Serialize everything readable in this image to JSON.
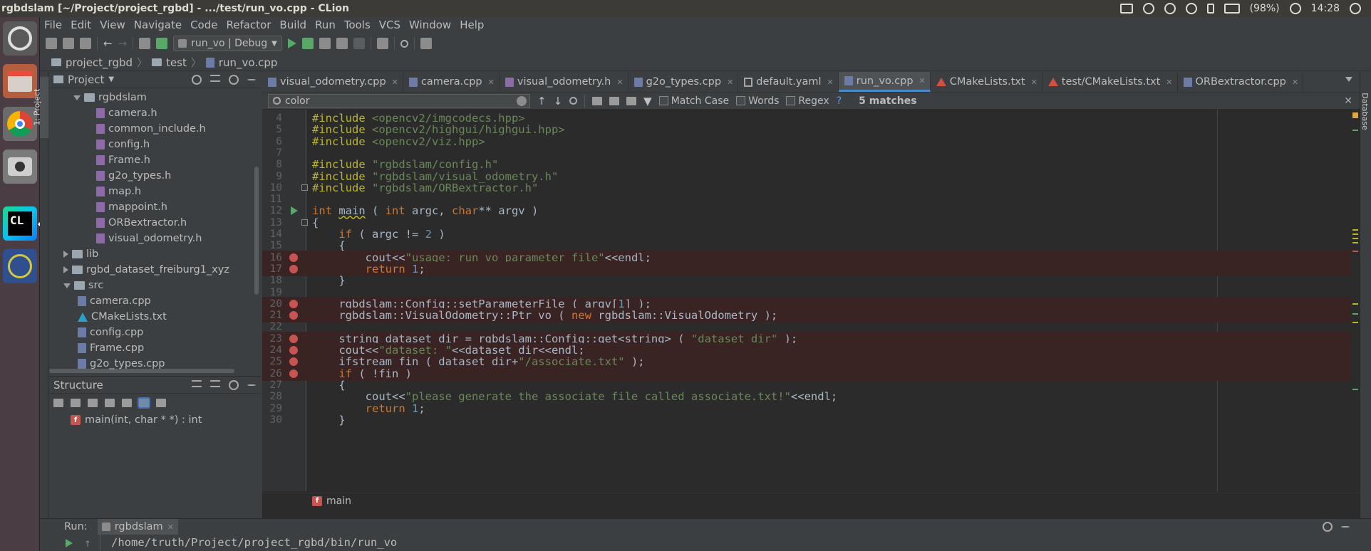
{
  "window": {
    "title": "rgbdslam [~/Project/project_rgbd] - .../test/run_vo.cpp - CLion"
  },
  "system_tray": {
    "battery": "(98%)",
    "time": "14:28"
  },
  "launcher": {
    "apps": [
      "ubuntu-dash-icon",
      "file-cabinet-icon",
      "chrome-icon",
      "camera-icon",
      "clion-icon",
      "settings-star-icon"
    ],
    "clion_badge": "CL"
  },
  "menu": {
    "items": [
      "File",
      "Edit",
      "View",
      "Navigate",
      "Code",
      "Refactor",
      "Build",
      "Run",
      "Tools",
      "VCS",
      "Window",
      "Help"
    ]
  },
  "toolbar": {
    "run_config": "run_vo | Debug"
  },
  "breadcrumb": {
    "items": [
      "project_rgbd",
      "test",
      "run_vo.cpp"
    ]
  },
  "left_strip": {
    "tab": "1: Project"
  },
  "right_strip": {
    "tab": "Database"
  },
  "project_panel": {
    "title": "Project",
    "tree": [
      {
        "label": "rgbdslam",
        "type": "dir",
        "state": "open",
        "depth": 1
      },
      {
        "label": "camera.h",
        "type": "h",
        "depth": 2
      },
      {
        "label": "common_include.h",
        "type": "h",
        "depth": 2
      },
      {
        "label": "config.h",
        "type": "h",
        "depth": 2
      },
      {
        "label": "Frame.h",
        "type": "h",
        "depth": 2
      },
      {
        "label": "g2o_types.h",
        "type": "h",
        "depth": 2
      },
      {
        "label": "map.h",
        "type": "h",
        "depth": 2
      },
      {
        "label": "mappoint.h",
        "type": "h",
        "depth": 2
      },
      {
        "label": "ORBextractor.h",
        "type": "h",
        "depth": 2
      },
      {
        "label": "visual_odometry.h",
        "type": "h",
        "depth": 2
      },
      {
        "label": "lib",
        "type": "dir",
        "state": "closed",
        "depth": 0
      },
      {
        "label": "rgbd_dataset_freiburg1_xyz",
        "type": "dir",
        "state": "closed",
        "depth": 0
      },
      {
        "label": "src",
        "type": "dir",
        "state": "open",
        "depth": 0
      },
      {
        "label": "camera.cpp",
        "type": "cpp",
        "depth": 1
      },
      {
        "label": "CMakeLists.txt",
        "type": "txt",
        "depth": 1
      },
      {
        "label": "config.cpp",
        "type": "cpp",
        "depth": 1
      },
      {
        "label": "Frame.cpp",
        "type": "cpp",
        "depth": 1
      },
      {
        "label": "g2o_types.cpp",
        "type": "cpp",
        "depth": 1
      }
    ]
  },
  "structure_panel": {
    "title": "Structure",
    "items": [
      {
        "badge": "f",
        "label": "main(int, char * *) : int"
      }
    ]
  },
  "editor": {
    "tabs": [
      {
        "label": "visual_odometry.cpp",
        "icon": "cpp"
      },
      {
        "label": "camera.cpp",
        "icon": "cpp"
      },
      {
        "label": "visual_odometry.h",
        "icon": "h"
      },
      {
        "label": "g2o_types.cpp",
        "icon": "cpp"
      },
      {
        "label": "default.yaml",
        "icon": "yaml"
      },
      {
        "label": "run_vo.cpp",
        "icon": "cpp",
        "active": true
      },
      {
        "label": "CMakeLists.txt",
        "icon": "cmake"
      },
      {
        "label": "test/CMakeLists.txt",
        "icon": "cmake"
      },
      {
        "label": "ORBextractor.cpp",
        "icon": "cpp"
      }
    ],
    "find": {
      "query": "color",
      "match_case": "Match Case",
      "words": "Words",
      "regex": "Regex",
      "help": "?",
      "matches": "5 matches"
    },
    "lines": [
      {
        "n": "4",
        "tokens": [
          [
            "pp",
            "#include "
          ],
          [
            "inc",
            "<opencv2/imgcodecs.hpp>"
          ]
        ]
      },
      {
        "n": "5",
        "tokens": [
          [
            "pp",
            "#include "
          ],
          [
            "inc",
            "<opencv2/highgui/highgui.hpp>"
          ]
        ]
      },
      {
        "n": "6",
        "tokens": [
          [
            "pp",
            "#include "
          ],
          [
            "inc",
            "<opencv2/viz.hpp>"
          ]
        ]
      },
      {
        "n": "7",
        "tokens": []
      },
      {
        "n": "8",
        "tokens": [
          [
            "pp",
            "#include "
          ],
          [
            "inc",
            "\"rgbdslam/config.h\""
          ]
        ]
      },
      {
        "n": "9",
        "tokens": [
          [
            "pp",
            "#include "
          ],
          [
            "inc",
            "\"rgbdslam/visual_odometry.h\""
          ]
        ]
      },
      {
        "n": "10",
        "tokens": [
          [
            "pp",
            "#include "
          ],
          [
            "inc",
            "\"rgbdslam/ORBextractor.h\""
          ]
        ],
        "fold": true
      },
      {
        "n": "11",
        "tokens": []
      },
      {
        "n": "12",
        "tokens": [
          [
            "kw",
            "int "
          ],
          [
            "fn",
            "main"
          ],
          [
            "op",
            " ( "
          ],
          [
            "kw",
            "int "
          ],
          [
            "op",
            "argc, "
          ],
          [
            "kw",
            "char"
          ],
          [
            "op",
            "** argv )"
          ]
        ],
        "run": true
      },
      {
        "n": "13",
        "tokens": [
          [
            "op",
            "{"
          ]
        ],
        "fold": true
      },
      {
        "n": "14",
        "tokens": [
          [
            "op",
            "    "
          ],
          [
            "kw",
            "if"
          ],
          [
            "op",
            " ( argc != "
          ],
          [
            "num",
            "2"
          ],
          [
            "op",
            " )"
          ]
        ]
      },
      {
        "n": "15",
        "tokens": [
          [
            "op",
            "    {"
          ]
        ]
      },
      {
        "n": "16",
        "tokens": [
          [
            "op",
            "        cout<<"
          ],
          [
            "str",
            "\"usage: run_vo parameter_file\""
          ],
          [
            "op",
            "<<endl;"
          ]
        ],
        "bp": true
      },
      {
        "n": "17",
        "tokens": [
          [
            "op",
            "        "
          ],
          [
            "kw",
            "return "
          ],
          [
            "num",
            "1"
          ],
          [
            "op",
            ";"
          ]
        ],
        "bp": true
      },
      {
        "n": "18",
        "tokens": [
          [
            "op",
            "    }"
          ]
        ]
      },
      {
        "n": "19",
        "tokens": []
      },
      {
        "n": "20",
        "tokens": [
          [
            "op",
            "    rgbdslam::Config::setParameterFile ( argv["
          ],
          [
            "num",
            "1"
          ],
          [
            "op",
            "] );"
          ]
        ],
        "bp": true
      },
      {
        "n": "21",
        "tokens": [
          [
            "op",
            "    rgbdslam::VisualOdometry::Ptr vo ( "
          ],
          [
            "kw",
            "new "
          ],
          [
            "op",
            "rgbdslam::VisualOdometry );"
          ]
        ],
        "bp": true
      },
      {
        "n": "22",
        "tokens": []
      },
      {
        "n": "23",
        "tokens": [
          [
            "op",
            "    string dataset_dir = rgbdslam::Config::get<string> ( "
          ],
          [
            "str",
            "\"dataset_dir\""
          ],
          [
            "op",
            " );"
          ]
        ],
        "bp": true
      },
      {
        "n": "24",
        "tokens": [
          [
            "op",
            "    cout<<"
          ],
          [
            "str",
            "\"dataset: \""
          ],
          [
            "op",
            "<<dataset_dir<<endl;"
          ]
        ],
        "bp": true
      },
      {
        "n": "25",
        "tokens": [
          [
            "op",
            "    ifstream fin ( dataset_dir+"
          ],
          [
            "str",
            "\"/associate.txt\""
          ],
          [
            "op",
            " );"
          ]
        ],
        "bp": true
      },
      {
        "n": "26",
        "tokens": [
          [
            "op",
            "    "
          ],
          [
            "kw",
            "if"
          ],
          [
            "op",
            " ( !fin )"
          ]
        ],
        "bp": true
      },
      {
        "n": "27",
        "tokens": [
          [
            "op",
            "    {"
          ]
        ]
      },
      {
        "n": "28",
        "tokens": [
          [
            "op",
            "        cout<<"
          ],
          [
            "str",
            "\"please generate the associate file called associate.txt!\""
          ],
          [
            "op",
            "<<endl;"
          ]
        ]
      },
      {
        "n": "29",
        "tokens": [
          [
            "op",
            "        "
          ],
          [
            "kw",
            "return "
          ],
          [
            "num",
            "1"
          ],
          [
            "op",
            ";"
          ]
        ]
      },
      {
        "n": "30",
        "tokens": [
          [
            "op",
            "    }"
          ]
        ]
      }
    ],
    "breadcrumb_fn": "main"
  },
  "run_panel": {
    "label": "Run:",
    "tab": "rgbdslam",
    "output": "/home/truth/Project/project_rgbd/bin/run_vo"
  },
  "colors": {
    "editor_bg": "#2b2b2b",
    "panel_bg": "#3c3f41",
    "keyword": "#cc7832",
    "preprocessor": "#bbb529",
    "string": "#6a8759",
    "number": "#6897bb",
    "breakpoint": "#c75450",
    "breakpoint_line": "#3a2323"
  }
}
